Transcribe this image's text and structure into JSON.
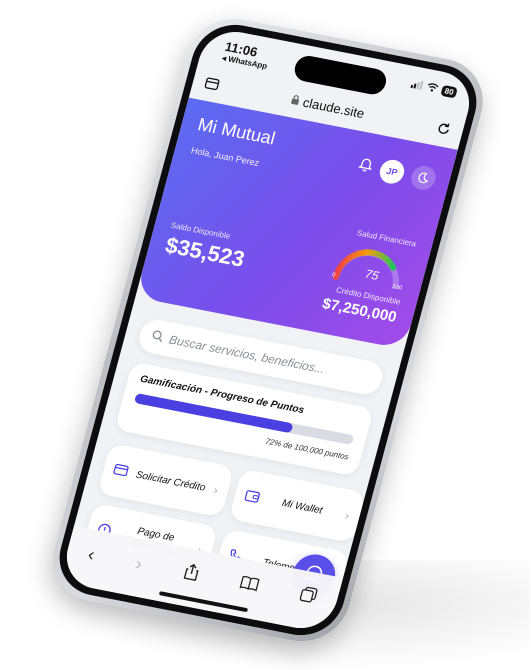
{
  "status": {
    "time": "11:06",
    "back_app": "◂ WhatsApp",
    "battery": "80"
  },
  "browser": {
    "url": "claude.site"
  },
  "app": {
    "title": "Mi Mutual",
    "greeting": "Hola, Juan Perez",
    "avatar_initials": "JP",
    "salud_label": "Salud Financiera",
    "saldo_label": "Saldo Disponible",
    "saldo_value": "$35,523",
    "score": "75",
    "score_min": "0",
    "score_max": "100",
    "credito_label": "Crédito Disponible",
    "credito_value": "$7,250,000"
  },
  "search": {
    "placeholder": "Buscar servicios, beneficios..."
  },
  "gamification": {
    "title": "Gamificación - Progreso de Puntos",
    "progress": 0.72,
    "caption": "72% de 100,000 puntos"
  },
  "actions": [
    {
      "label": "Solicitar Crédito",
      "icon": "card-icon"
    },
    {
      "label": "Mi Wallet",
      "icon": "wallet-icon"
    },
    {
      "label": "Pago de Servicios",
      "icon": "clock-icon"
    },
    {
      "label": "Telemedicina",
      "icon": "phone-icon"
    }
  ],
  "toolbar": {
    "back": "‹",
    "forward": "›"
  },
  "colors": {
    "hero_start": "#5b6bf2",
    "hero_end": "#a24be8",
    "accent": "#4a3fe0"
  }
}
